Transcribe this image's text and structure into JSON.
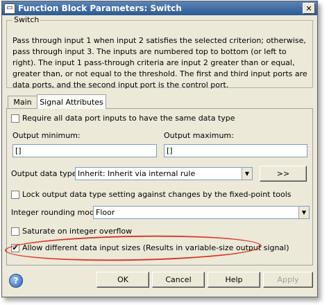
{
  "window": {
    "title": "Function Block Parameters: Switch",
    "close_glyph": "✕",
    "icon_glyph": "▭"
  },
  "group": {
    "legend": "Switch",
    "description": "Pass through input 1 when input 2 satisfies the selected criterion; otherwise, pass through input 3.  The inputs are numbered top to bottom (or left to right). The input 1 pass-through criteria are input 2 greater than or equal, greater than, or not equal to the threshold.  The first and third input ports are data ports, and the second input port is the control port."
  },
  "tabs": [
    {
      "label": "Main",
      "selected": false
    },
    {
      "label": "Signal Attributes",
      "selected": true
    }
  ],
  "panel": {
    "require_same_type": {
      "label": "Require all data port inputs to have the same data type",
      "checked": false
    },
    "output_minimum": {
      "label": "Output minimum:",
      "value": "[]"
    },
    "output_maximum": {
      "label": "Output maximum:",
      "value": "[]"
    },
    "output_data_type": {
      "label": "Output data type:",
      "value": "Inherit: Inherit via internal rule",
      "assistant_label": ">>"
    },
    "lock_data_type": {
      "label": "Lock output data type setting against changes by the fixed-point tools",
      "checked": false
    },
    "integer_rounding": {
      "label": "Integer rounding mode:",
      "value": "Floor"
    },
    "saturate": {
      "label": "Saturate on integer overflow",
      "checked": false
    },
    "allow_different_sizes": {
      "label": "Allow different data input sizes (Results in variable-size output signal)",
      "checked": true,
      "check_glyph": "✔"
    }
  },
  "buttons": {
    "ok": "OK",
    "cancel": "Cancel",
    "help": "Help",
    "apply": "Apply",
    "help_icon_glyph": "?"
  },
  "dropdown_arrow_glyph": "▼",
  "colors": {
    "titlebar": "#2d5a92",
    "highlight": "#d8382a",
    "dialog_bg": "#ece9d8"
  }
}
